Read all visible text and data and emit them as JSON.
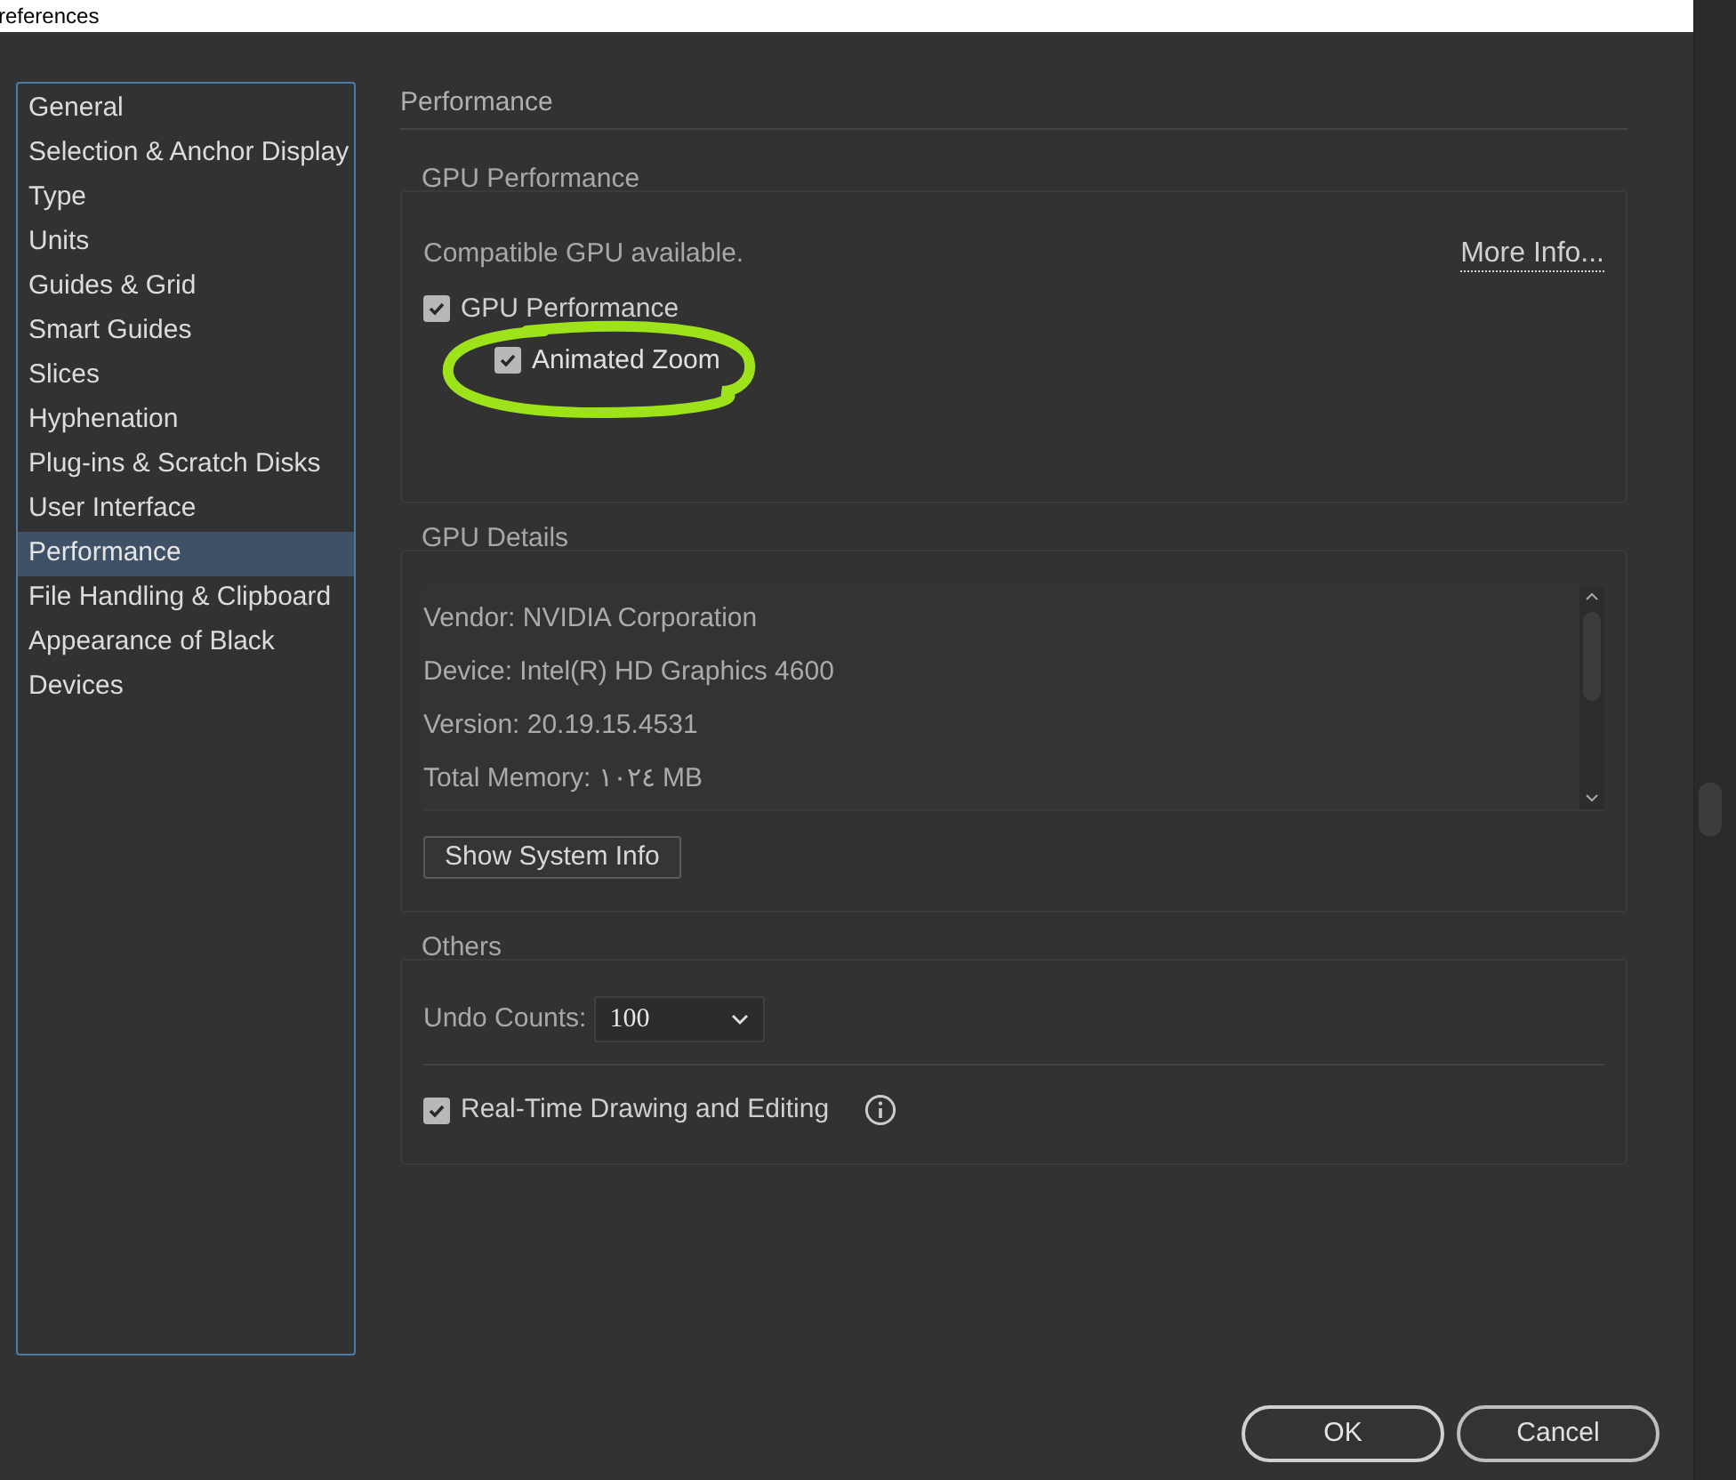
{
  "window": {
    "title": "references"
  },
  "sidebar": {
    "items": [
      {
        "label": "General",
        "selected": false
      },
      {
        "label": "Selection & Anchor Display",
        "selected": false
      },
      {
        "label": "Type",
        "selected": false
      },
      {
        "label": "Units",
        "selected": false
      },
      {
        "label": "Guides & Grid",
        "selected": false
      },
      {
        "label": "Smart Guides",
        "selected": false
      },
      {
        "label": "Slices",
        "selected": false
      },
      {
        "label": "Hyphenation",
        "selected": false
      },
      {
        "label": "Plug-ins & Scratch Disks",
        "selected": false
      },
      {
        "label": "User Interface",
        "selected": false
      },
      {
        "label": "Performance",
        "selected": true
      },
      {
        "label": "File Handling & Clipboard",
        "selected": false
      },
      {
        "label": "Appearance of Black",
        "selected": false
      },
      {
        "label": "Devices",
        "selected": false
      }
    ]
  },
  "page_title": "Performance",
  "gpu_performance": {
    "title": "GPU Performance",
    "status": "Compatible GPU available.",
    "link": "More Info...",
    "options": [
      {
        "label": "GPU Performance",
        "checked": true,
        "nested": false
      },
      {
        "label": "Animated Zoom",
        "checked": true,
        "nested": true
      }
    ]
  },
  "gpu_details": {
    "title": "GPU Details",
    "lines": [
      "Vendor: NVIDIA Corporation",
      "Device: Intel(R) HD Graphics 4600",
      "Version: 20.19.15.4531",
      "Total Memory: ١٠٢٤ MB"
    ],
    "button": "Show System Info"
  },
  "others": {
    "title": "Others",
    "undo_label": "Undo Counts:",
    "undo_value": "100",
    "realtime": {
      "label": "Real-Time Drawing and Editing",
      "checked": true
    }
  },
  "buttons": {
    "ok": "OK",
    "cancel": "Cancel"
  }
}
